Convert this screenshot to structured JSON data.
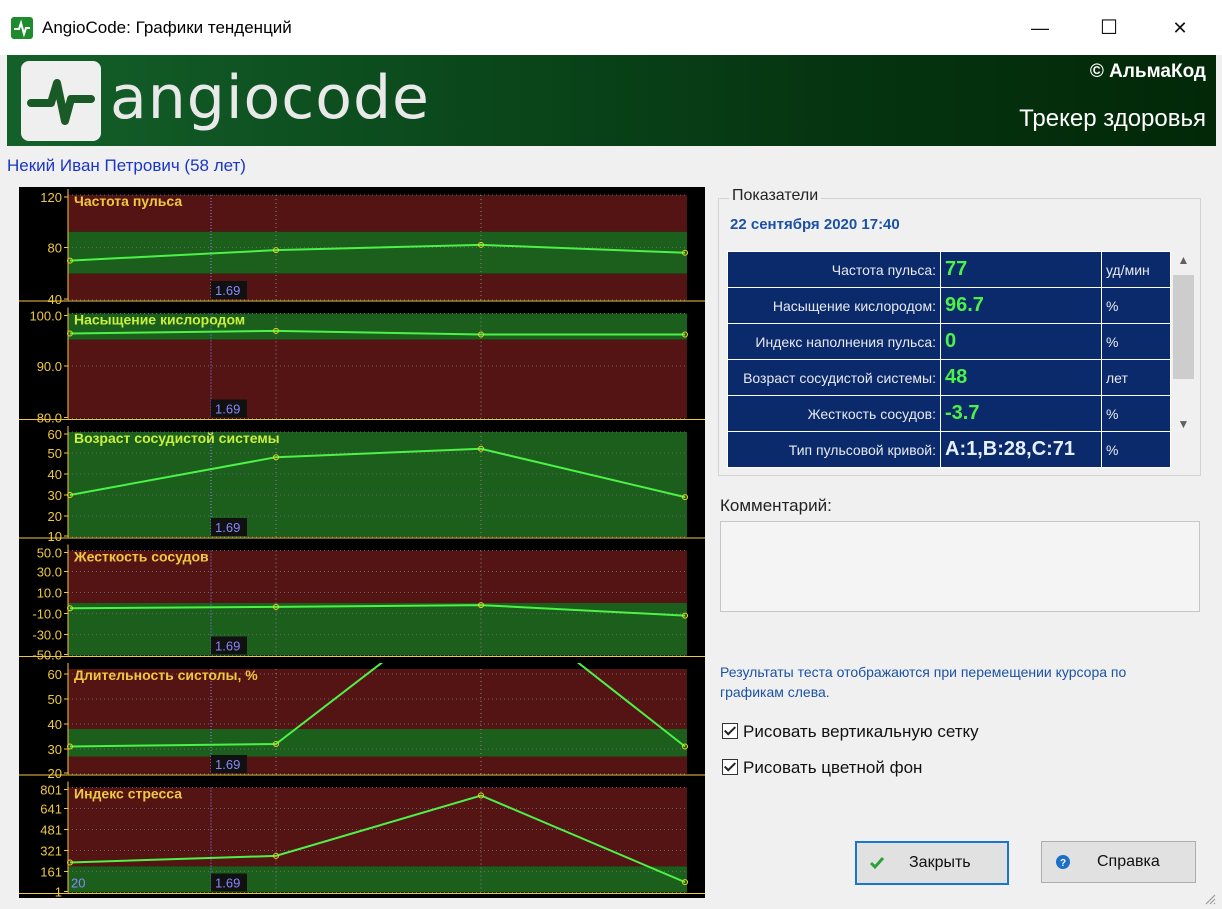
{
  "window": {
    "title": "AngioCode: Графики тенденций",
    "minimize": "—",
    "maximize": "☐",
    "close": "✕"
  },
  "banner": {
    "logo_text": "angiocode",
    "copyright": "© АльмаКод",
    "tagline": "Трекер здоровья"
  },
  "patient": "Некий Иван Петрович (58 лет)",
  "colors": {
    "line": "#4cf247",
    "marker": "#f0d020",
    "title": "#f0c840",
    "title2": "#c8f040",
    "cursor": "#8888ff",
    "green_band": "#1c5e1c",
    "red_band": "#551414"
  },
  "chart_data": [
    {
      "type": "line",
      "title": "Частота пульса",
      "title_color": "#f0c840",
      "ticks": [
        {
          "v": 120,
          "t": "120"
        },
        {
          "v": 80,
          "t": "80"
        },
        {
          "v": 40,
          "t": "40"
        }
      ],
      "ylim": [
        40,
        120
      ],
      "values": [
        70,
        78,
        82,
        76
      ],
      "green_band": [
        60,
        92
      ],
      "cursor_label": "1.69"
    },
    {
      "type": "line",
      "title": "Насыщение кислородом",
      "title_color": "#c8f040",
      "ticks": [
        {
          "v": 100,
          "t": "100.0"
        },
        {
          "v": 90,
          "t": "90.0"
        },
        {
          "v": 80,
          "t": "80.0"
        }
      ],
      "ylim": [
        80,
        100
      ],
      "values": [
        96.2,
        96.7,
        96,
        96
      ],
      "green_band": [
        95,
        100
      ],
      "cursor_label": "1.69"
    },
    {
      "type": "line",
      "title": "Возраст сосудистой системы",
      "title_color": "#c8f040",
      "ticks": [
        {
          "v": 60,
          "t": "60"
        },
        {
          "v": 50,
          "t": "50"
        },
        {
          "v": 40,
          "t": "40"
        },
        {
          "v": 30,
          "t": "30"
        },
        {
          "v": 20,
          "t": "20"
        },
        {
          "v": 10,
          "t": "10"
        }
      ],
      "ylim": [
        10,
        60
      ],
      "values": [
        30,
        48,
        52,
        29
      ],
      "green_band": [
        10,
        60
      ],
      "cursor_label": "1.69"
    },
    {
      "type": "line",
      "title": "Жесткость сосудов",
      "title_color": "#f0c840",
      "ticks": [
        {
          "v": 50,
          "t": "50.0"
        },
        {
          "v": 30,
          "t": "30.0"
        },
        {
          "v": 10,
          "t": "10.0"
        },
        {
          "v": -10,
          "t": "-10.0"
        },
        {
          "v": -30,
          "t": "-30.0"
        },
        {
          "v": -50,
          "t": "-50.0"
        }
      ],
      "ylim": [
        -50,
        50
      ],
      "values": [
        -5,
        -3.7,
        -2,
        -12
      ],
      "green_band": [
        -50,
        0
      ],
      "cursor_label": "1.69"
    },
    {
      "type": "line",
      "title": "Длительность систолы, %",
      "title_color": "#f0c840",
      "ticks": [
        {
          "v": 60,
          "t": "60"
        },
        {
          "v": 50,
          "t": "50"
        },
        {
          "v": 40,
          "t": "40"
        },
        {
          "v": 30,
          "t": "30"
        },
        {
          "v": 20,
          "t": "20"
        }
      ],
      "ylim": [
        20,
        62
      ],
      "values": [
        31,
        32,
        95,
        31
      ],
      "green_band": [
        27,
        38
      ],
      "cursor_label": "1.69"
    },
    {
      "type": "line",
      "title": "Индекс стресса",
      "title_color": "#f0c840",
      "ticks": [
        {
          "v": 801,
          "t": "801"
        },
        {
          "v": 641,
          "t": "641"
        },
        {
          "v": 481,
          "t": "481"
        },
        {
          "v": 321,
          "t": "321"
        },
        {
          "v": 161,
          "t": "161"
        },
        {
          "v": 1,
          "t": "1"
        }
      ],
      "ylim": [
        1,
        801
      ],
      "values": [
        230,
        280,
        740,
        80
      ],
      "green_band": [
        1,
        200
      ],
      "cursor_label": "1.69",
      "left_label": "20"
    }
  ],
  "indicators": {
    "group_title": "Показатели",
    "date": "22 сентября 2020  17:40",
    "rows": [
      {
        "label": "Частота пульса:",
        "value": "77",
        "unit": "уд/мин"
      },
      {
        "label": "Насыщение кислородом:",
        "value": "96.7",
        "unit": "%"
      },
      {
        "label": "Индекс наполнения пульса:",
        "value": "0",
        "unit": "%"
      },
      {
        "label": "Возраст сосудистой системы:",
        "value": "48",
        "unit": "лет"
      },
      {
        "label": "Жесткость сосудов:",
        "value": "-3.7",
        "unit": "%"
      },
      {
        "label": "Тип пульсовой кривой:",
        "value": "A:1,B:28,C:71",
        "unit": "%"
      }
    ]
  },
  "comment": {
    "label": "Комментарий:",
    "text": ""
  },
  "hint": "Результаты теста отображаются при перемещении курсора по графикам слева.",
  "options": {
    "vertical_grid": "Рисовать вертикальную сетку",
    "color_bg": "Рисовать цветной фон"
  },
  "buttons": {
    "close": "Закрыть",
    "help": "Справка"
  }
}
